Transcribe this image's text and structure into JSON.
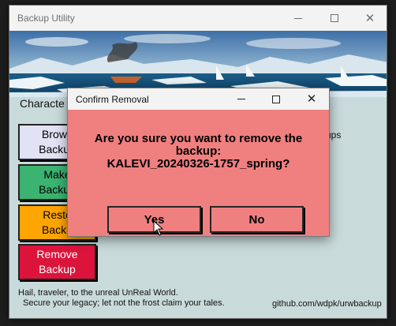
{
  "main_window": {
    "title": "Backup Utility",
    "character_label": "Characte",
    "backups_fragment": "ups"
  },
  "actions": {
    "browse": "Brows\nBackup",
    "make": "Make\nBackup",
    "restore": "Resto\nBacku",
    "remove": "Remove\nBackup"
  },
  "footer": {
    "line1": "Hail, traveler, to the unreal UnReal World.",
    "line2": "Secure your legacy; let not the frost claim your tales.",
    "link": "github.com/wdpk/urwbackup"
  },
  "dialog": {
    "title": "Confirm Removal",
    "message_line1": "Are you sure you want to remove the",
    "message_line2": "backup:",
    "message_line3": "KALEVI_20240326-1757_spring?",
    "yes_label": "Yes",
    "no_label": "No"
  },
  "colors": {
    "dialog_bg": "#f08080",
    "make_bg": "#3cb371",
    "restore_bg": "#ffa500",
    "remove_bg": "#dc143c",
    "browse_bg": "#e2e2f6"
  },
  "icons": {
    "minimize": "minimize-icon",
    "maximize": "maximize-icon",
    "close": "close-icon",
    "cursor": "mouse-pointer-icon"
  }
}
